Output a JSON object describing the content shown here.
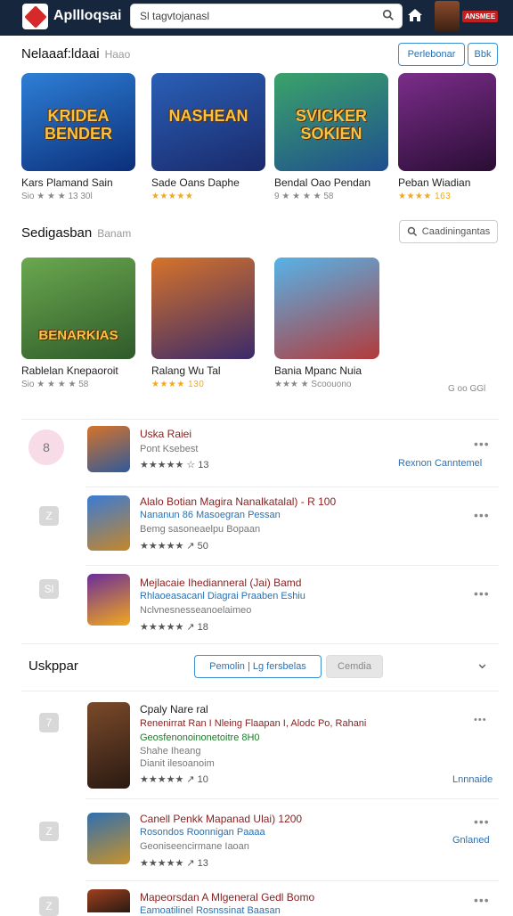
{
  "header": {
    "brand": "Apllloqsai",
    "search_value": "Sl tagvtojanasl",
    "badge": "ANSMEE"
  },
  "featured": {
    "title": "Nelaaaf:ldaai",
    "subtitle": "Haao",
    "btn_primary": "Perlebonar",
    "btn_secondary": "Bbk",
    "cards": [
      {
        "thumb_text": "KRIDEA BENDER",
        "title": "Kars Plamand Sain",
        "meta": "Sio ★ ★ ★ 13 30l",
        "colors": [
          "#2e7fd6",
          "#0b2f7a"
        ]
      },
      {
        "thumb_text": "NASHEAN",
        "title": "Sade Oans Daphe",
        "meta": "★★★★★",
        "colors": [
          "#2a5fb6",
          "#1a2a6b"
        ]
      },
      {
        "thumb_text": "SVICKER SOKIEN",
        "title": "Bendal Oao Pendan",
        "meta": "9 ★ ★ ★ ★ 58",
        "colors": [
          "#3aa36a",
          "#1f4f8f"
        ]
      },
      {
        "thumb_text": "",
        "title": "Peban Wiadian",
        "meta": "★★★★ 163",
        "colors": [
          "#7b2d8a",
          "#2a0d35"
        ]
      }
    ]
  },
  "suggested": {
    "title": "Sedigasban",
    "subtitle": "Banam",
    "btn": "Caadiningantas",
    "cards": [
      {
        "thumb_text": "BENARKIAS",
        "title": "Rablelan Knepaoroit",
        "meta": "Sio ★ ★ ★ ★ 58",
        "colors": [
          "#6aa84f",
          "#2f5a2a"
        ]
      },
      {
        "thumb_text": "",
        "title": "Ralang Wu Tal",
        "meta": "★★★★ 130",
        "colors": [
          "#d6732a",
          "#3a2a6b"
        ]
      },
      {
        "thumb_text": "",
        "title": "Bania Mpanc Nuia",
        "meta": "★★★ ★ Scoouono",
        "colors": [
          "#56b3e8",
          "#b23b3b"
        ]
      }
    ],
    "extra_meta": "G oo GGl"
  },
  "list1": [
    {
      "badge": "8",
      "title": "Uska Raiei",
      "line1": "Pont Ksebest",
      "line2": "",
      "line3": "",
      "rating": "★★★★★ ☆ 13",
      "link": "Rexnon Canntemel",
      "colors": [
        "#d6732a",
        "#2f5a9a"
      ],
      "pink": true
    },
    {
      "badge": "Z",
      "title": "Alalo Botian Magira Nanalkatalal) - R 100",
      "line1": "Nananun 86 Masoegran Pessan",
      "line2": "Bemg sasoneaelpu Bopaan",
      "line3": "",
      "rating": "★★★★★ ↗ 50",
      "link": "",
      "colors": [
        "#3a7bd5",
        "#c4872a"
      ],
      "pink": false
    },
    {
      "badge": "Sl",
      "title": "Mejlacaie Ihedianneral (Jai) Bamd",
      "line1": "Rhlaoeasacanl Diagrai Praaben Eshiu",
      "line2": "Nclvnesnesseanoelaimeo",
      "line3": "",
      "rating": "★★★★★ ↗ 18",
      "link": "",
      "colors": [
        "#6b2d9a",
        "#f2a81d"
      ],
      "pink": false
    }
  ],
  "more": {
    "title": "Uskppar",
    "btn_primary": "Pemolin | Lg fersbelas",
    "btn_disabled": "Cemdia",
    "chevron": "⌄"
  },
  "list2": [
    {
      "badge": "7",
      "title": "Cpaly Nare ral",
      "line1": "Renenirrat Ran I Nleing Flaapan I, Alodc Po, Rahani",
      "line2": "Geosfenonoinonetoitre 8H0",
      "line3": "Shahe Iheang",
      "line4": "Dianit ilesoanoim",
      "rating": "★★★★★ ↗ 10",
      "link": "Lnnnaide",
      "colors": [
        "#7a4a2a",
        "#2a1a12"
      ]
    },
    {
      "badge": "Z",
      "title": "Canell Penkk Mapanad Ulai) 1200",
      "line1": "Rosondos Roonnigan Paaaa",
      "line2": "Geoniseencirmane Iaoan",
      "line3": "",
      "line4": "",
      "rating": "★★★★★ ↗ 13",
      "link": "Gnlaned",
      "colors": [
        "#2f6fb0",
        "#c8922a"
      ]
    },
    {
      "badge": "Z",
      "title": "Mapeorsdan A Mlgeneral Gedl Bomo",
      "line1": "Eamoatilinel Rosnssinat Baasan",
      "line2": "",
      "line3": "",
      "line4": "",
      "rating": "",
      "link": "",
      "colors": [
        "#a04020",
        "#2a1a12"
      ]
    }
  ]
}
